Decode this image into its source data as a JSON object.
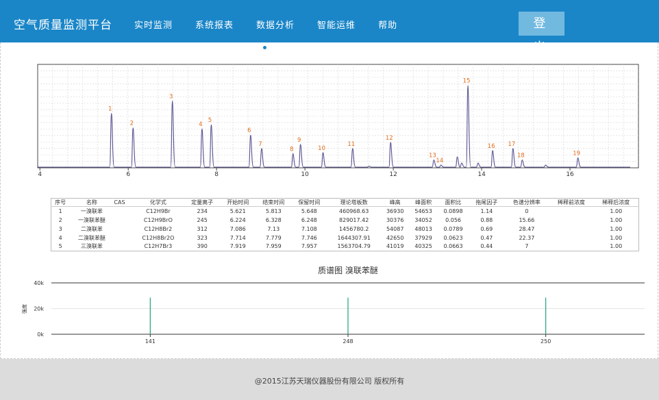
{
  "header": {
    "brand": "空气质量监测平台",
    "nav": [
      "实时监测",
      "系统报表",
      "数据分析",
      "智能运维",
      "帮助"
    ],
    "logout_label": "登出"
  },
  "chromatogram": {
    "x_ticks": [
      "4",
      "6",
      "8",
      "10",
      "12",
      "14",
      "16"
    ],
    "xlim": [
      3.95,
      17.55
    ],
    "peaks": [
      {
        "label": "1",
        "rt": 5.62,
        "height": 0.52
      },
      {
        "label": "2",
        "rt": 6.11,
        "height": 0.38
      },
      {
        "label": "3",
        "rt": 7.0,
        "height": 0.64
      },
      {
        "label": "4",
        "rt": 7.67,
        "height": 0.37
      },
      {
        "label": "5",
        "rt": 7.88,
        "height": 0.41
      },
      {
        "label": "6",
        "rt": 8.77,
        "height": 0.31
      },
      {
        "label": "7",
        "rt": 9.02,
        "height": 0.18
      },
      {
        "label": "8",
        "rt": 9.73,
        "height": 0.13
      },
      {
        "label": "9",
        "rt": 9.9,
        "height": 0.22
      },
      {
        "label": "10",
        "rt": 10.41,
        "height": 0.14
      },
      {
        "label": "11",
        "rt": 11.08,
        "height": 0.18
      },
      {
        "label": "12",
        "rt": 11.94,
        "height": 0.24
      },
      {
        "label": "13",
        "rt": 12.92,
        "height": 0.07
      },
      {
        "label": "14",
        "rt": 13.08,
        "height": 0.02
      },
      {
        "label": "15",
        "rt": 13.69,
        "height": 0.79
      },
      {
        "label": "16",
        "rt": 14.25,
        "height": 0.16
      },
      {
        "label": "17",
        "rt": 14.71,
        "height": 0.18
      },
      {
        "label": "18",
        "rt": 14.92,
        "height": 0.07
      },
      {
        "label": "19",
        "rt": 16.18,
        "height": 0.09
      }
    ],
    "minor_peaks": [
      {
        "rt": 11.45,
        "height": 0.01
      },
      {
        "rt": 13.45,
        "height": 0.1
      },
      {
        "rt": 13.55,
        "height": 0.04
      },
      {
        "rt": 13.92,
        "height": 0.04
      },
      {
        "rt": 15.45,
        "height": 0.02
      }
    ]
  },
  "table": {
    "headers": [
      "序号",
      "名称",
      "CAS",
      "化学式",
      "定量离子",
      "开始时间",
      "结束时间",
      "保留时间",
      "理论塔板数",
      "峰高",
      "峰面积",
      "面积比",
      "拖尾因子",
      "色谱分辨率",
      "稀释前浓度",
      "稀释后浓度"
    ],
    "rows": [
      [
        "1",
        "一溴联苯",
        "",
        "C12H9Br",
        "234",
        "5.621",
        "5.813",
        "5.648",
        "460968.63",
        "36930",
        "54653",
        "0.0898",
        "1.14",
        "0",
        "",
        "1.00"
      ],
      [
        "2",
        "一溴联苯醚",
        "",
        "C12H9BrO",
        "245",
        "6.224",
        "6.328",
        "6.248",
        "829017.42",
        "30376",
        "34052",
        "0.056",
        "0.88",
        "15.66",
        "",
        "1.00"
      ],
      [
        "3",
        "二溴联苯",
        "",
        "C12H8Br2",
        "312",
        "7.086",
        "7.13",
        "7.108",
        "1456780.2",
        "54087",
        "48013",
        "0.0789",
        "0.69",
        "28.47",
        "",
        "1.00"
      ],
      [
        "4",
        "二溴联苯醚",
        "",
        "C12H8Br2O",
        "323",
        "7.714",
        "7.779",
        "7.746",
        "1644307.91",
        "42650",
        "37929",
        "0.0623",
        "0.47",
        "22.37",
        "",
        "1.00"
      ],
      [
        "5",
        "三溴联苯",
        "",
        "C12H7Br3",
        "390",
        "7.919",
        "7.959",
        "7.957",
        "1563704.79",
        "41019",
        "40325",
        "0.0663",
        "0.44",
        "7",
        "",
        "1.00"
      ]
    ]
  },
  "chart_data": {
    "type": "bar",
    "title": "质谱图 溴联苯醚",
    "ylabel": "强度",
    "ylim": [
      0,
      40000
    ],
    "y_ticks": [
      "0k",
      "20k",
      "40k"
    ],
    "categories": [
      "141",
      "248",
      "250"
    ],
    "values": [
      28500,
      28500,
      28500
    ],
    "colors": {
      "bar": "#1aa37a",
      "axis": "#333333"
    }
  },
  "footer": {
    "copyright": "@2015江苏天瑞仪器股份有限公司   版权所有"
  }
}
